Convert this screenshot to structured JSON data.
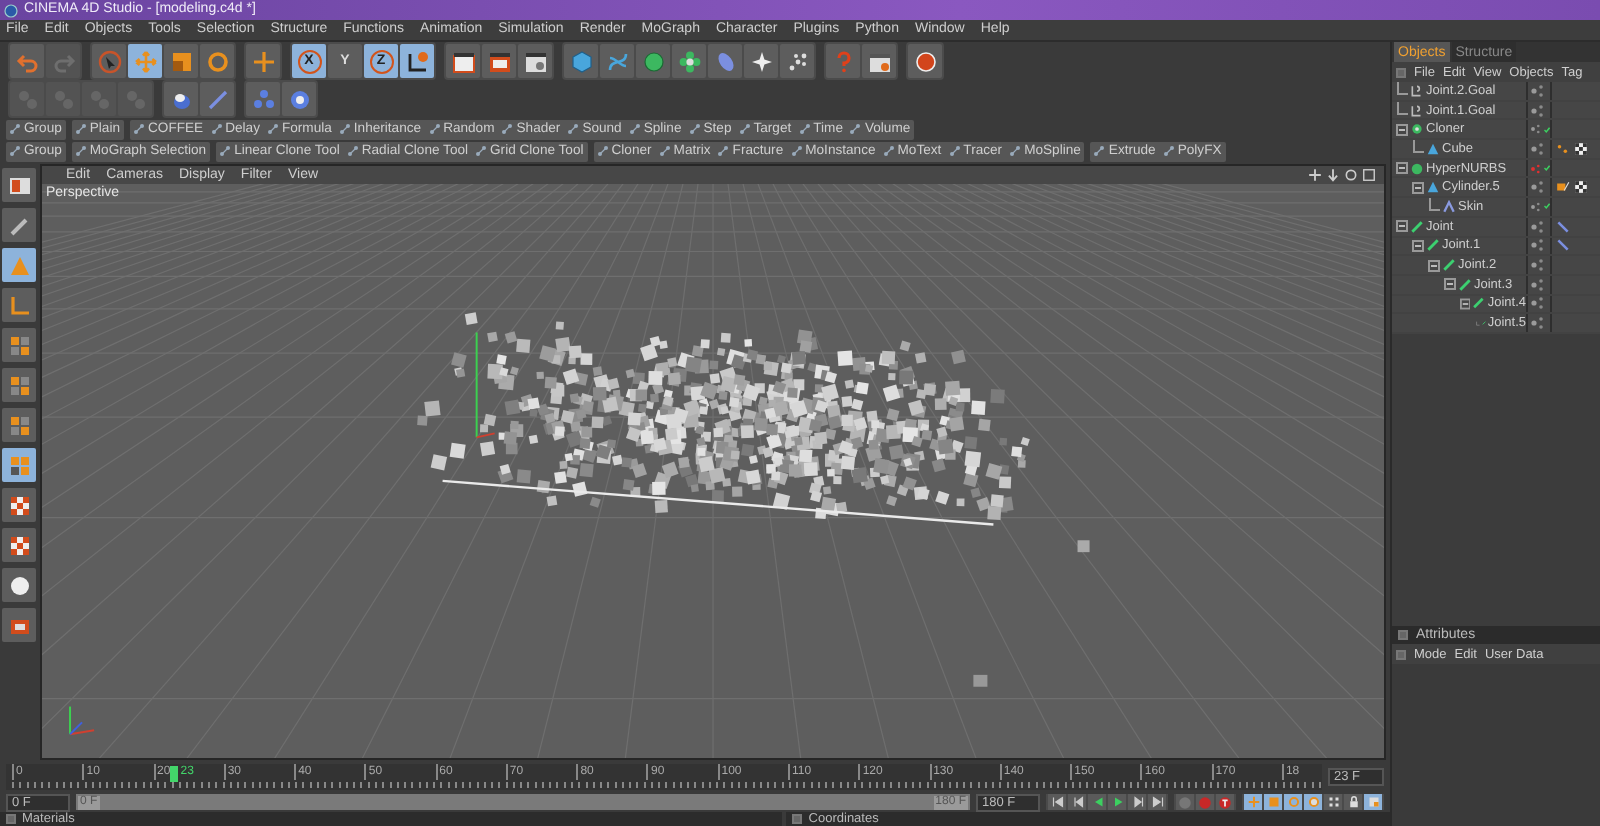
{
  "window": {
    "title": "CINEMA 4D Studio - [modeling.c4d *]"
  },
  "menu_bar": [
    "File",
    "Edit",
    "Objects",
    "Tools",
    "Selection",
    "Structure",
    "Functions",
    "Animation",
    "Simulation",
    "Render",
    "MoGraph",
    "Character",
    "Plugins",
    "Python",
    "Window",
    "Help"
  ],
  "main_toolbar": [
    [
      {
        "kind": "undo",
        "selected": false,
        "disabled": false
      },
      {
        "kind": "redo",
        "selected": false,
        "disabled": true
      }
    ],
    [
      {
        "kind": "select",
        "selected": false,
        "disabled": false
      },
      {
        "kind": "move",
        "selected": true,
        "disabled": false
      },
      {
        "kind": "scale",
        "selected": false,
        "disabled": false
      },
      {
        "kind": "rotate",
        "selected": false,
        "disabled": false
      }
    ],
    [
      {
        "kind": "crosshair",
        "selected": false,
        "disabled": false
      }
    ],
    [
      {
        "kind": "axis",
        "label": "X",
        "selected": true,
        "disabled": false
      },
      {
        "kind": "axis",
        "label": "Y",
        "selected": false,
        "disabled": false
      },
      {
        "kind": "axis",
        "label": "Z",
        "selected": true,
        "disabled": false
      },
      {
        "kind": "coords",
        "selected": true,
        "disabled": false
      }
    ],
    [
      {
        "kind": "render",
        "selected": false,
        "disabled": false
      },
      {
        "kind": "render-red",
        "selected": false,
        "disabled": false
      },
      {
        "kind": "render-gear",
        "selected": false,
        "disabled": false
      }
    ],
    [
      {
        "kind": "cube",
        "selected": false,
        "disabled": false
      },
      {
        "kind": "spline",
        "selected": false,
        "disabled": false
      },
      {
        "kind": "sphere",
        "selected": false,
        "disabled": false
      },
      {
        "kind": "flower",
        "selected": false,
        "disabled": false
      },
      {
        "kind": "capsule",
        "selected": false,
        "disabled": false
      },
      {
        "kind": "star",
        "selected": false,
        "disabled": false
      },
      {
        "kind": "particles",
        "selected": false,
        "disabled": false
      }
    ],
    [
      {
        "kind": "help",
        "selected": false,
        "disabled": false
      },
      {
        "kind": "calendar",
        "selected": false,
        "disabled": false
      }
    ],
    [
      {
        "kind": "ball",
        "selected": false,
        "disabled": false
      }
    ]
  ],
  "mode_toolbar": [
    [
      {
        "kind": "mode",
        "selected": false,
        "disabled": true
      },
      {
        "kind": "mode",
        "selected": false,
        "disabled": true
      },
      {
        "kind": "mode",
        "selected": false,
        "disabled": true
      },
      {
        "kind": "mode",
        "selected": false,
        "disabled": true
      }
    ],
    [
      {
        "kind": "bucket",
        "selected": false,
        "disabled": false
      },
      {
        "kind": "knife",
        "selected": false,
        "disabled": false
      }
    ],
    [
      {
        "kind": "snap",
        "selected": false,
        "disabled": false
      },
      {
        "kind": "gear",
        "selected": false,
        "disabled": false
      }
    ]
  ],
  "xpresso_bar": [
    [
      "Group"
    ],
    [
      "Plain"
    ],
    [
      "COFFEE",
      "Delay",
      "Formula",
      "Inheritance",
      "Random",
      "Shader",
      "Sound",
      "Spline",
      "Step",
      "Target",
      "Time",
      "Volume"
    ]
  ],
  "mograph_bar": [
    [
      "Group"
    ],
    [
      "MoGraph Selection"
    ],
    [
      "Linear Clone Tool",
      "Radial Clone Tool",
      "Grid Clone Tool"
    ],
    [
      "Cloner",
      "Matrix",
      "Fracture",
      "MoInstance",
      "MoText",
      "Tracer",
      "MoSpline"
    ],
    [
      "Extrude",
      "PolyFX"
    ]
  ],
  "left_toolbar": [
    {
      "kind": "layout",
      "selected": false
    },
    {
      "kind": "brush",
      "selected": false
    },
    {
      "kind": "cone",
      "selected": true
    },
    {
      "kind": "axis-mode",
      "selected": false
    },
    {
      "kind": "grid",
      "selected": false
    },
    {
      "kind": "grid",
      "selected": false
    },
    {
      "kind": "grid",
      "selected": false
    },
    {
      "kind": "grid-orange",
      "selected": true
    },
    {
      "kind": "checker",
      "selected": false
    },
    {
      "kind": "checker",
      "selected": false
    },
    {
      "kind": "ball-white",
      "selected": false
    },
    {
      "kind": "camera",
      "selected": false
    }
  ],
  "viewport": {
    "menu": [
      "Edit",
      "Cameras",
      "Display",
      "Filter",
      "View"
    ],
    "label": "Perspective"
  },
  "timeline": {
    "ruler": [
      "0",
      "10",
      "20",
      "30",
      "40",
      "50",
      "60",
      "70",
      "80",
      "90",
      "100",
      "110",
      "120",
      "130",
      "140",
      "150",
      "160",
      "170",
      "18"
    ],
    "marker": {
      "label": "23",
      "level": 0.128
    },
    "frame_field": "23 F",
    "start_field": "0 F",
    "range": {
      "start": "0 F",
      "end": "180 F",
      "level": 1
    },
    "end_field": "180 F",
    "transport": [
      {
        "kind": "first"
      },
      {
        "kind": "prev-key"
      },
      {
        "kind": "play-back"
      },
      {
        "kind": "play"
      },
      {
        "kind": "next-key"
      },
      {
        "kind": "last"
      }
    ],
    "record": [
      {
        "kind": "record-off"
      },
      {
        "kind": "record"
      },
      {
        "kind": "autokey"
      }
    ],
    "key_modes": [
      {
        "kind": "position",
        "selected": true
      },
      {
        "kind": "scale",
        "selected": true
      },
      {
        "kind": "rotation",
        "selected": true
      },
      {
        "kind": "parameter",
        "selected": true
      },
      {
        "kind": "points",
        "selected": false
      },
      {
        "kind": "lock",
        "selected": false
      },
      {
        "kind": "scheme",
        "selected": true
      }
    ]
  },
  "bottom_panels": [
    "Materials",
    "Coordinates"
  ],
  "objects_panel": {
    "tabs": [
      {
        "label": "Objects",
        "selected": true
      },
      {
        "label": "Structure",
        "selected": false
      }
    ],
    "menu": [
      "File",
      "Edit",
      "View",
      "Objects",
      "Tag"
    ],
    "tree": [
      {
        "name": "Joint.2.Goal",
        "kind": "goal",
        "hidden": false,
        "enabled": false
      },
      {
        "name": "Joint.1.Goal",
        "kind": "goal",
        "hidden": false,
        "enabled": false
      },
      {
        "name": "Cloner",
        "kind": "cloner",
        "expanded": true,
        "hidden": false,
        "enabled": true,
        "children": [
          {
            "name": "Cube",
            "kind": "cube",
            "hidden": false,
            "enabled": false,
            "tags": [
              {
                "kind": "points"
              },
              {
                "kind": "checker"
              }
            ]
          }
        ]
      },
      {
        "name": "HyperNURBS",
        "kind": "nurbs",
        "expanded": true,
        "hidden": true,
        "enabled": true,
        "children": [
          {
            "name": "Cylinder.5",
            "kind": "cube",
            "expanded": true,
            "hidden": false,
            "enabled": false,
            "tags": [
              {
                "kind": "uvw"
              },
              {
                "kind": "checker"
              }
            ],
            "children": [
              {
                "name": "Skin",
                "kind": "skin",
                "hidden": false,
                "enabled": true
              }
            ]
          }
        ]
      },
      {
        "name": "Joint",
        "kind": "joint",
        "expanded": true,
        "hidden": false,
        "enabled": false,
        "tags": [
          {
            "kind": "ik"
          }
        ],
        "children": [
          {
            "name": "Joint.1",
            "kind": "joint",
            "expanded": true,
            "hidden": false,
            "enabled": false,
            "tags": [
              {
                "kind": "ik"
              }
            ],
            "children": [
              {
                "name": "Joint.2",
                "kind": "joint",
                "expanded": true,
                "hidden": false,
                "enabled": false,
                "children": [
                  {
                    "name": "Joint.3",
                    "kind": "joint",
                    "expanded": true,
                    "hidden": false,
                    "enabled": false,
                    "children": [
                      {
                        "name": "Joint.4",
                        "kind": "joint",
                        "expanded": true,
                        "hidden": false,
                        "enabled": false,
                        "children": [
                          {
                            "name": "Joint.5",
                            "kind": "joint",
                            "hidden": false,
                            "enabled": false
                          }
                        ]
                      }
                    ]
                  }
                ]
              }
            ]
          }
        ]
      }
    ]
  },
  "attributes_panel": {
    "title": "Attributes",
    "menu": [
      "Mode",
      "Edit",
      "User Data"
    ]
  }
}
